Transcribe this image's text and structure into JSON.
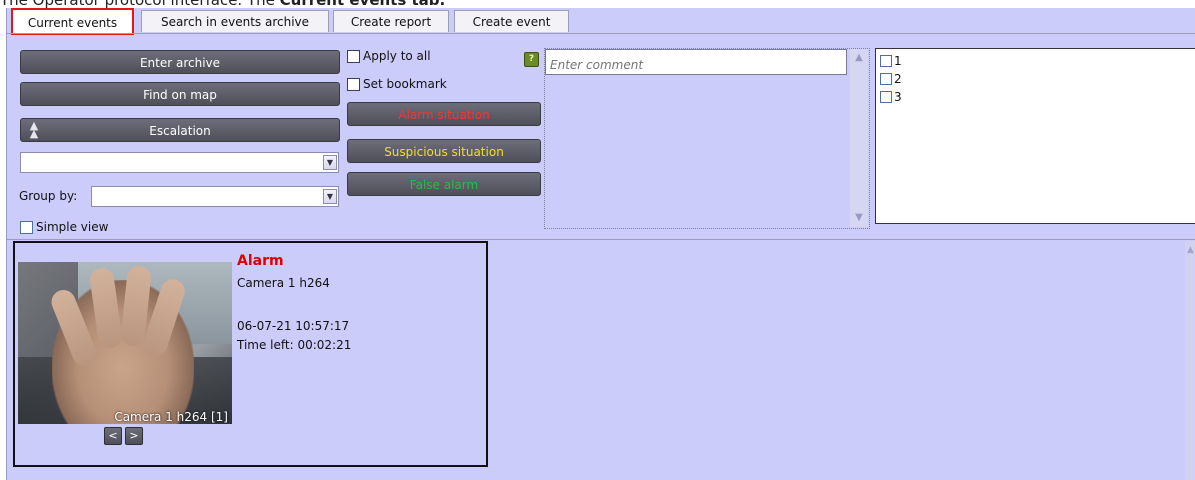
{
  "caption": {
    "prefix": "The Operator protocol interface. The ",
    "bold": "Current events",
    "suffix": " tab."
  },
  "tabs": [
    {
      "label": "Current events",
      "active": true
    },
    {
      "label": "Search in events archive",
      "active": false
    },
    {
      "label": "Create report",
      "active": false
    },
    {
      "label": "Create event",
      "active": false
    }
  ],
  "left_panel": {
    "enter_archive": "Enter archive",
    "find_on_map": "Find on map",
    "escalation": "Escalation",
    "group_by_label": "Group by:",
    "simple_view_label": "Simple view"
  },
  "options": {
    "apply_to_all": "Apply to all",
    "set_bookmark": "Set bookmark"
  },
  "situations": {
    "alarm": {
      "label": "Alarm situation",
      "color": "#ff3030"
    },
    "suspicious": {
      "label": "Suspicious situation",
      "color": "#f0e020"
    },
    "false_alarm": {
      "label": "False alarm",
      "color": "#20c040"
    }
  },
  "comment": {
    "placeholder": "Enter comment",
    "help_icon": "question-icon"
  },
  "cameras": [
    "1",
    "2",
    "3"
  ],
  "event": {
    "title": "Alarm",
    "camera": "Camera 1 h264",
    "timestamp": "06-07-21 10:57:17",
    "time_left": "Time left: 00:02:21",
    "thumbnail_caption": "Camera 1 h264 [1]",
    "prev": "<",
    "next": ">"
  },
  "colors": {
    "background": "#ccccfa",
    "active_tab_highlight": "#e3161a",
    "alarm_title": "#e00000"
  }
}
